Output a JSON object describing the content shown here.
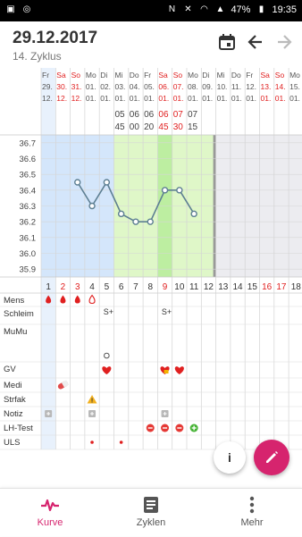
{
  "status_bar": {
    "battery": "47%",
    "time": "19:35"
  },
  "header": {
    "title": "29.12.2017",
    "subtitle": "14. Zyklus",
    "icons": [
      "calendar-icon",
      "arrow-back-icon",
      "arrow-forward-icon"
    ]
  },
  "colors": {
    "accent": "#d6246e",
    "period_bg": "#d4e6fb",
    "fertile_bg": "#dff7c8",
    "ovulation_bg": "#bdeea1",
    "line": "#5d7f92",
    "weekend_red": "#e02020",
    "gray_bg": "#ececf0"
  },
  "days": [
    {
      "wd": "Fr",
      "d": "29.",
      "m": "12.",
      "red": false
    },
    {
      "wd": "Sa",
      "d": "30.",
      "m": "12.",
      "red": true
    },
    {
      "wd": "So",
      "d": "31.",
      "m": "12.",
      "red": true
    },
    {
      "wd": "Mo",
      "d": "01.",
      "m": "01.",
      "red": false
    },
    {
      "wd": "Di",
      "d": "02.",
      "m": "01.",
      "red": false
    },
    {
      "wd": "Mi",
      "d": "03.",
      "m": "01.",
      "red": false
    },
    {
      "wd": "Do",
      "d": "04.",
      "m": "01.",
      "red": false
    },
    {
      "wd": "Fr",
      "d": "05.",
      "m": "01.",
      "red": false
    },
    {
      "wd": "Sa",
      "d": "06.",
      "m": "01.",
      "red": true
    },
    {
      "wd": "So",
      "d": "07.",
      "m": "01.",
      "red": true
    },
    {
      "wd": "Mo",
      "d": "08.",
      "m": "01.",
      "red": false
    },
    {
      "wd": "Di",
      "d": "09.",
      "m": "01.",
      "red": false
    },
    {
      "wd": "Mi",
      "d": "10.",
      "m": "01.",
      "red": false
    },
    {
      "wd": "Do",
      "d": "11.",
      "m": "01.",
      "red": false
    },
    {
      "wd": "Fr",
      "d": "12.",
      "m": "01.",
      "red": false
    },
    {
      "wd": "Sa",
      "d": "13.",
      "m": "01.",
      "red": true
    },
    {
      "wd": "So",
      "d": "14.",
      "m": "01.",
      "red": true
    },
    {
      "wd": "Mo",
      "d": "15.",
      "m": "01.",
      "red": false
    }
  ],
  "times": [
    {
      "day": 6,
      "h": "05",
      "m": "45"
    },
    {
      "day": 7,
      "h": "06",
      "m": "00"
    },
    {
      "day": 8,
      "h": "06",
      "m": "20"
    },
    {
      "day": 9,
      "h": "06",
      "m": "45"
    },
    {
      "day": 10,
      "h": "07",
      "m": "30"
    },
    {
      "day": 11,
      "h": "07",
      "m": "15"
    }
  ],
  "chart_data": {
    "type": "line",
    "y_ticks": [
      "36.7",
      "36.6",
      "36.5",
      "36.4",
      "36.3",
      "36.2",
      "36.1",
      "36.0",
      "35.9"
    ],
    "ylim": [
      35.85,
      36.75
    ],
    "cycle_days": [
      "1",
      "2",
      "3",
      "4",
      "5",
      "6",
      "7",
      "8",
      "9",
      "10",
      "11",
      "12",
      "13",
      "14",
      "15",
      "16",
      "17",
      "18"
    ],
    "red_cycle_days": [
      2,
      3,
      9,
      16,
      17
    ],
    "period_days": [
      1,
      5
    ],
    "fertile_days": [
      6,
      12
    ],
    "ovulation_day": 9,
    "temperatures": [
      {
        "day": 3,
        "temp": 36.45
      },
      {
        "day": 4,
        "temp": 36.3
      },
      {
        "day": 5,
        "temp": 36.45
      },
      {
        "day": 6,
        "temp": 36.25
      },
      {
        "day": 7,
        "temp": 36.2
      },
      {
        "day": 8,
        "temp": 36.2
      },
      {
        "day": 9,
        "temp": 36.4
      },
      {
        "day": 10,
        "temp": 36.4
      },
      {
        "day": 11,
        "temp": 36.25
      }
    ]
  },
  "rows": {
    "labels": [
      "Mens",
      "Schleim",
      "MuMu",
      "GV",
      "Medi",
      "Strfak",
      "Notiz",
      "LH-Test",
      "ULS"
    ],
    "schleim_text": "S+",
    "mens": [
      {
        "day": 1,
        "type": "drop-heart"
      },
      {
        "day": 2,
        "type": "drop-heart"
      },
      {
        "day": 3,
        "type": "drop-heart"
      },
      {
        "day": 4,
        "type": "drop-outline"
      }
    ],
    "schleim": [
      {
        "day": 5,
        "text": "S+"
      },
      {
        "day": 9,
        "text": "S+"
      }
    ],
    "mumu": [
      {
        "day": 5,
        "type": "circle"
      }
    ],
    "gv": [
      {
        "day": 5,
        "type": "heart"
      },
      {
        "day": 9,
        "type": "heart-lock"
      },
      {
        "day": 10,
        "type": "heart"
      }
    ],
    "medi": [
      {
        "day": 2,
        "type": "pill"
      }
    ],
    "strfak": [
      {
        "day": 4,
        "type": "warning"
      }
    ],
    "notiz": [
      {
        "day": 1,
        "type": "note"
      },
      {
        "day": 4,
        "type": "note"
      },
      {
        "day": 9,
        "type": "note"
      }
    ],
    "lh": [
      {
        "day": 8,
        "type": "minus"
      },
      {
        "day": 9,
        "type": "minus"
      },
      {
        "day": 10,
        "type": "minus"
      },
      {
        "day": 11,
        "type": "plus"
      }
    ],
    "uls": [
      {
        "day": 4,
        "type": "dot"
      },
      {
        "day": 6,
        "type": "dot"
      }
    ]
  },
  "fab": {
    "info": "i"
  },
  "nav": {
    "items": [
      {
        "label": "Kurve"
      },
      {
        "label": "Zyklen"
      },
      {
        "label": "Mehr"
      }
    ]
  }
}
